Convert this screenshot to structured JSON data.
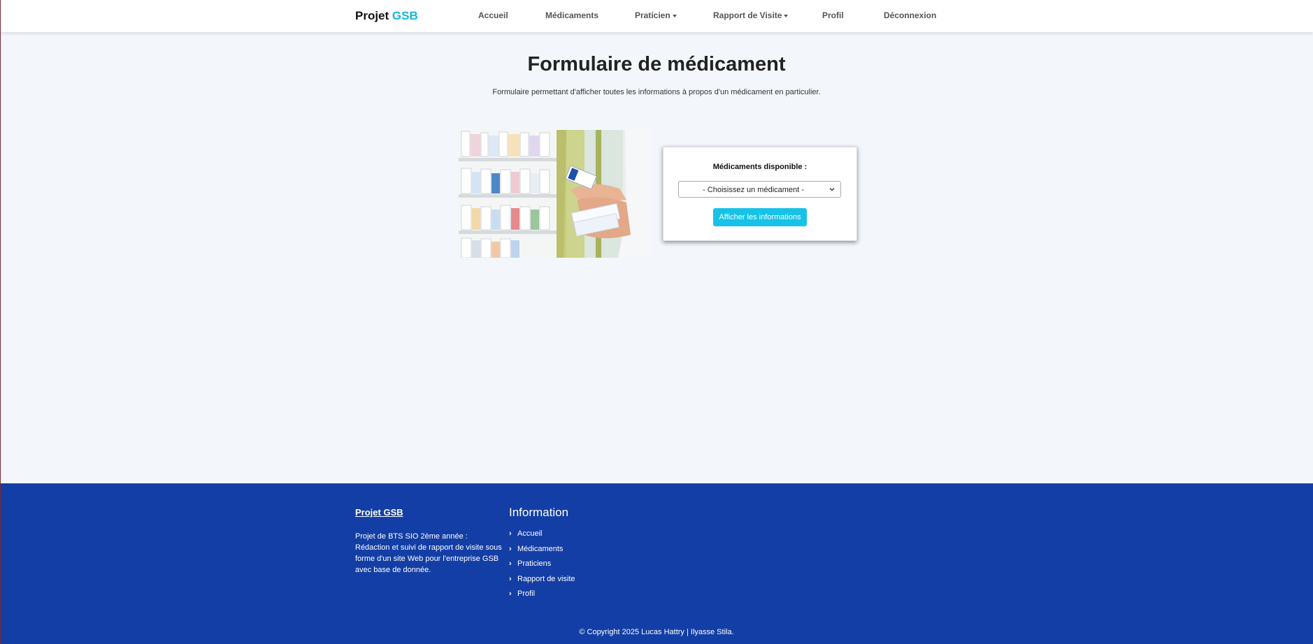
{
  "header": {
    "brand": {
      "main": "Projet",
      "accent": "GSB"
    },
    "nav": [
      {
        "label": "Accueil",
        "dropdown": false
      },
      {
        "label": "Médicaments",
        "dropdown": false
      },
      {
        "label": "Praticien",
        "dropdown": true
      },
      {
        "label": "Rapport de Visite",
        "dropdown": true
      },
      {
        "label": "Profil",
        "dropdown": false
      },
      {
        "label": "Déconnexion",
        "dropdown": false
      }
    ]
  },
  "main": {
    "title": "Formulaire de médicament",
    "description": "Formulaire permettant d'afficher toutes les informations à propos d'un médicament en particulier.",
    "form": {
      "label": "Médicaments disponible :",
      "select_value": "- Choisissez un médicament -",
      "submit_label": "Afficher les informations"
    }
  },
  "footer": {
    "brand": "Projet GSB",
    "description": "Projet de BTS SIO 2ème année : Rédaction et suivi de rapport de visite sous forme d'un site Web pour l'entreprise GSB avec base de donnée.",
    "info_heading": "Information",
    "links": [
      "Accueil",
      "Médicaments",
      "Praticiens",
      "Rapport de visite",
      "Profil"
    ],
    "copyright": "© Copyright 2025 Lucas Hattry | Ilyasse Stila."
  },
  "colors": {
    "accent": "#10b9e0",
    "button": "#17c2e8",
    "footer_bg": "#133ea5",
    "page_bg": "#f3f7fc"
  }
}
